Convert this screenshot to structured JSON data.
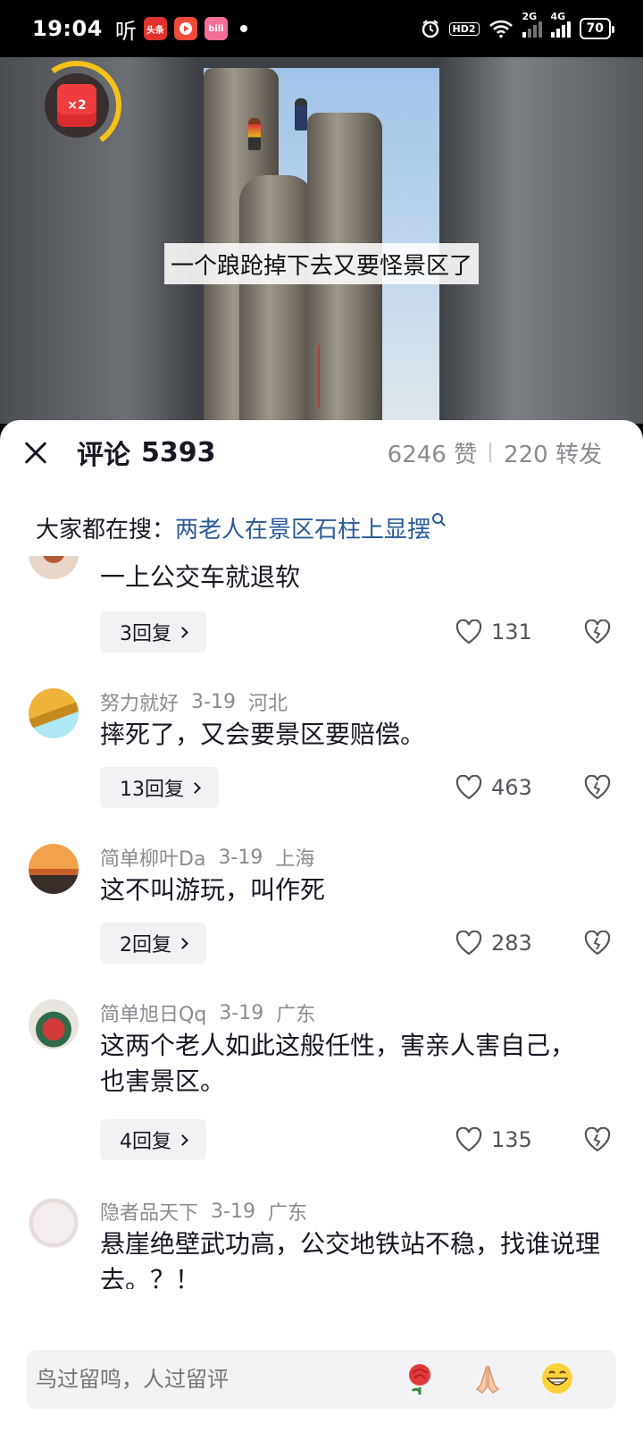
{
  "status_bar": {
    "time": "19:04",
    "listen_glyph": "听",
    "app_badges": [
      "头条",
      "",
      "bili"
    ],
    "hd_label": "HD2",
    "net_2g": "2G",
    "net_4g": "4G",
    "battery": "70"
  },
  "video": {
    "caption": "一个踉跄掉下去又要怪景区了",
    "redpacket_label": "×2"
  },
  "comments_header": {
    "title": "评论",
    "count": "5393",
    "likes": "6246 赞",
    "shares": "220 转发"
  },
  "search": {
    "prefix": "大家都在搜：",
    "query": "两老人在景区石柱上显摆"
  },
  "comments": [
    {
      "username": "",
      "date": "",
      "location": "",
      "text": "一上公交车就退软",
      "replies": "3回复",
      "likes": "131"
    },
    {
      "username": "努力就好",
      "date": "3-19",
      "location": "河北",
      "text": "摔死了，又会要景区要赔偿。",
      "replies": "13回复",
      "likes": "463"
    },
    {
      "username": "简单柳叶Da",
      "date": "3-19",
      "location": "上海",
      "text": "这不叫游玩，叫作死",
      "replies": "2回复",
      "likes": "283"
    },
    {
      "username": "简单旭日Qq",
      "date": "3-19",
      "location": "广东",
      "text": "这两个老人如此这般任性，害亲人害自己，也害景区。",
      "replies": "4回复",
      "likes": "135"
    },
    {
      "username": "隐者品天下",
      "date": "3-19",
      "location": "广东",
      "text": "悬崖绝壁武功高，公交地铁站不稳，找谁说理去。？！",
      "replies": "",
      "likes": ""
    }
  ],
  "input": {
    "placeholder": "鸟过留鸣，人过留评"
  },
  "colors": {
    "link": "#2a5b97",
    "muted": "#8a8b91",
    "text": "#161823",
    "redpacket": "#ef3d3d",
    "ring": "#f5c21a"
  },
  "icons": [
    "close-icon",
    "search-icon",
    "heart-icon",
    "broken-heart-icon",
    "chevron-right-icon",
    "rose-emoji",
    "pray-emoji",
    "grin-emoji"
  ]
}
